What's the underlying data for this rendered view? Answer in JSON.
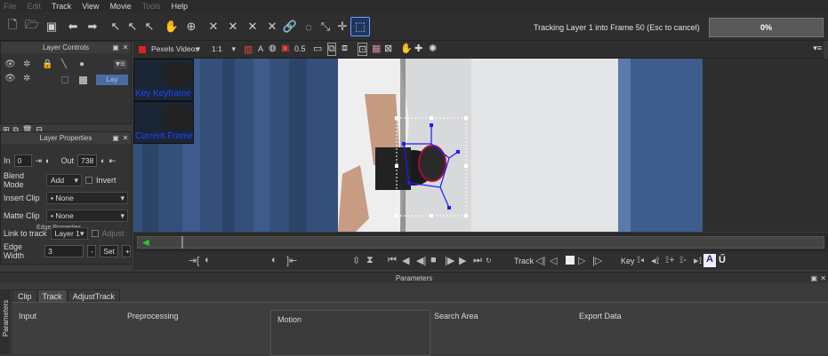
{
  "menu": [
    "File",
    "Edit",
    "Track",
    "View",
    "Movie",
    "Tools",
    "Help"
  ],
  "menu_disabled": [
    true,
    true,
    false,
    false,
    false,
    true,
    false
  ],
  "status": {
    "text": "Tracking Layer 1 into Frame 50 (Esc to cancel)",
    "progress": "0%"
  },
  "layer_controls": {
    "title": "Layer Controls",
    "layer_label": "Lay"
  },
  "layer_properties": {
    "title": "Layer Properties",
    "in_label": "In",
    "in_value": "0",
    "out_label": "Out",
    "out_value": "738",
    "blend_label": "Blend Mode",
    "blend_value": "Add",
    "invert_label": "Invert",
    "insert_label": "Insert Clip",
    "insert_value": "None",
    "matte_label": "Matte Clip",
    "matte_value": "None",
    "edge_props": "Edge Properties",
    "link_label": "Link to track",
    "link_value": "Layer 1",
    "adjust_label": "Adjust",
    "edge_width_label": "Edge Width",
    "edge_width_value": "3",
    "edge_set": "Set"
  },
  "viewer_toolbar": {
    "clip": "Pexels Videos",
    "zoom": "1:1",
    "opacity": "0.5",
    "a_label": "A"
  },
  "thumbs": [
    {
      "label": "Key Keyframe"
    },
    {
      "label": "Current Frame"
    }
  ],
  "transport": {
    "track_label": "Track",
    "key_label": "Key"
  },
  "parameters": {
    "title": "Parameters",
    "tabs": [
      "Clip",
      "Track",
      "AdjustTrack"
    ],
    "active_tab": 1,
    "sections": [
      "Input",
      "Preprocessing",
      "Motion",
      "Search Area",
      "Export Data"
    ],
    "side_label": "Parameters"
  },
  "colors": {
    "accent": "#4a6aa3",
    "progress_bg": "#595959"
  }
}
